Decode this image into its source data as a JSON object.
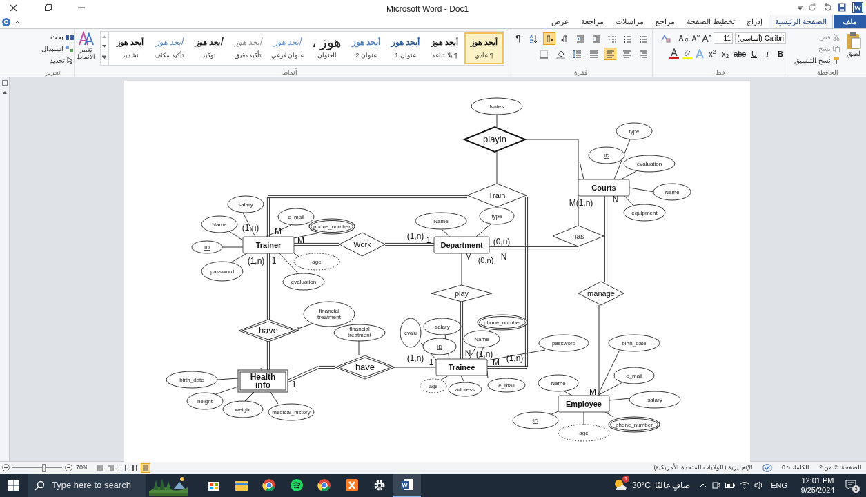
{
  "window": {
    "title": "Microsoft Word - Doc1"
  },
  "tabs": [
    {
      "label": "ملف",
      "kind": "file",
      "selected": false
    },
    {
      "label": "الصفحة الرئيسية",
      "kind": "tab",
      "selected": true
    },
    {
      "label": "إدراج",
      "kind": "tab",
      "selected": false
    },
    {
      "label": "تخطيط الصفحة",
      "kind": "tab",
      "selected": false
    },
    {
      "label": "مراجع",
      "kind": "tab",
      "selected": false
    },
    {
      "label": "مراسلات",
      "kind": "tab",
      "selected": false
    },
    {
      "label": "مراجعة",
      "kind": "tab",
      "selected": false
    },
    {
      "label": "عرض",
      "kind": "tab",
      "selected": false
    }
  ],
  "clipboard": {
    "paste": "لصق",
    "cut": "قص",
    "copy": "نسخ",
    "format_painter": "نسخ التنسيق",
    "group_label": "الحافظة"
  },
  "font": {
    "name": "Calibri (أساسي)",
    "size": "11",
    "group_label": "خط",
    "format_buttons": [
      {
        "label": "B",
        "kind": "bold"
      },
      {
        "label": "I",
        "kind": "italic"
      },
      {
        "label": "U",
        "kind": "underline"
      },
      {
        "label": "abc",
        "kind": "strike"
      },
      {
        "label": "x$_{2}$",
        "kind": "script"
      },
      {
        "label": "x$^{2}$",
        "kind": "script"
      }
    ]
  },
  "paragraph": {
    "group_label": "فقرة",
    "row1": [
      {
        "kind": "bullets",
        "selected": false
      },
      {
        "kind": "numbering",
        "selected": false
      },
      {
        "kind": "multilevel",
        "selected": false
      },
      {
        "kind": "outdent",
        "selected": false
      },
      {
        "kind": "indent",
        "selected": false
      },
      {
        "kind": "rtl",
        "selected": false
      },
      {
        "kind": "ltr",
        "selected": true
      },
      {
        "kind": "sort",
        "selected": false
      },
      {
        "kind": "marks",
        "label": "¶",
        "selected": false
      }
    ],
    "row2": [
      {
        "kind": "align-right",
        "selected": false
      },
      {
        "kind": "align-center",
        "selected": false
      },
      {
        "kind": "align-left",
        "selected": true
      },
      {
        "kind": "justify",
        "selected": false
      },
      {
        "kind": "spacing",
        "selected": false
      },
      {
        "kind": "shading",
        "selected": false
      },
      {
        "kind": "borders",
        "selected": false
      }
    ]
  },
  "styles": {
    "group_label": "أنماط",
    "change_styles": "تغيير الأنماط",
    "items": [
      {
        "preview": "أبجد هوز",
        "name": "¶ عادي",
        "kind": "normal",
        "selected": true
      },
      {
        "preview": "أبجد هوز",
        "name": "¶ بلا تباعد",
        "kind": "normal",
        "selected": false
      },
      {
        "preview": "أبجد هوز",
        "name": "عنوان 1",
        "kind": "heading1",
        "selected": false
      },
      {
        "preview": "أبجد هوز",
        "name": "عنوان 2",
        "kind": "heading2",
        "selected": false
      },
      {
        "preview": "هوز ،",
        "name": "العنوان",
        "kind": "title",
        "selected": false
      },
      {
        "preview": "أبجد هوز",
        "name": "عنوان فرعي",
        "kind": "subtitle",
        "selected": false
      },
      {
        "preview": "أبجد هوز",
        "name": "تأكيد دقيق",
        "kind": "subtle",
        "selected": false
      },
      {
        "preview": "أبجد هوز",
        "name": "توكيد",
        "kind": "emphasis",
        "selected": false
      },
      {
        "preview": "أبجد هوز",
        "name": "تأكيد مكثف",
        "kind": "intense",
        "selected": false
      },
      {
        "preview": "أبجد هوز",
        "name": "تشديد",
        "kind": "strong",
        "selected": false
      }
    ]
  },
  "editing": {
    "find": "بحث",
    "replace": "استبدال",
    "select": "تحديد",
    "group_label": "تحرير"
  },
  "diagram": {
    "entities": [
      {
        "label": "Trainer",
        "kind": "strong"
      },
      {
        "label": "Department",
        "kind": "strong"
      },
      {
        "label": "Courts",
        "kind": "strong"
      },
      {
        "label": "Trainee",
        "kind": "strong"
      },
      {
        "label": "Employee",
        "kind": "strong"
      },
      {
        "label": "Health info",
        "kind": "weak"
      }
    ],
    "relationships": [
      {
        "label": "playin",
        "kind": "bold"
      },
      {
        "label": "Train",
        "kind": "plain"
      },
      {
        "label": "Work",
        "kind": "plain"
      },
      {
        "label": "has",
        "kind": "plain"
      },
      {
        "label": "play",
        "kind": "plain"
      },
      {
        "label": "manage",
        "kind": "plain"
      },
      {
        "label": "have",
        "kind": "identifying"
      },
      {
        "label": "have",
        "kind": "identifying"
      }
    ],
    "attributes": [
      {
        "label": "Notes",
        "kind": "plain"
      },
      {
        "label": "type",
        "kind": "plain"
      },
      {
        "label": "evaluation",
        "kind": "plain"
      },
      {
        "label": "ID",
        "kind": "key"
      },
      {
        "label": "Name",
        "kind": "plain"
      },
      {
        "label": "equipment",
        "kind": "plain"
      },
      {
        "label": "salary",
        "kind": "plain"
      },
      {
        "label": "type",
        "kind": "plain"
      },
      {
        "label": "Name",
        "kind": "key"
      },
      {
        "label": "phone_number",
        "kind": "multivalued"
      },
      {
        "label": "e_mail",
        "kind": "plain"
      },
      {
        "label": "Name",
        "kind": "plain"
      },
      {
        "label": "ID",
        "kind": "key"
      },
      {
        "label": "age",
        "kind": "derived"
      },
      {
        "label": "evaluation",
        "kind": "plain"
      },
      {
        "label": "password",
        "kind": "plain"
      },
      {
        "label": "birth_date",
        "kind": "plain"
      },
      {
        "label": "password",
        "kind": "plain"
      },
      {
        "label": "phone_number",
        "kind": "multivalued"
      },
      {
        "label": "Name",
        "kind": "plain"
      },
      {
        "label": "salary",
        "kind": "plain"
      },
      {
        "label": "ID",
        "kind": "key"
      },
      {
        "label": "evalu",
        "kind": "plain"
      },
      {
        "label": "financial treatment",
        "kind": "plain"
      },
      {
        "label": "financial treatment",
        "kind": "plain"
      },
      {
        "label": "e_mail",
        "kind": "plain"
      },
      {
        "label": "Name",
        "kind": "plain"
      },
      {
        "label": "e_mail",
        "kind": "plain"
      },
      {
        "label": "address",
        "kind": "plain"
      },
      {
        "label": "age",
        "kind": "derived"
      },
      {
        "label": "birth_date",
        "kind": "plain"
      },
      {
        "label": "salary",
        "kind": "plain"
      },
      {
        "label": "phone_number",
        "kind": "multivalued"
      },
      {
        "label": "age",
        "kind": "derived"
      },
      {
        "label": "ID",
        "kind": "key"
      },
      {
        "label": "medical_history",
        "kind": "plain"
      },
      {
        "label": "weight",
        "kind": "plain"
      },
      {
        "label": "height",
        "kind": "plain"
      }
    ],
    "cardinalities": [
      "N",
      "M(1,n)",
      "(0,n)",
      "1",
      "(1,n)",
      "M",
      "M",
      "(1,n)",
      "N",
      "(0,n)",
      "M",
      "1",
      "(1,n)",
      "1",
      "(1,n)",
      "M",
      "(1,n)",
      "N",
      "1",
      "(1,n)",
      "1",
      "M",
      "1"
    ]
  },
  "status_bar": {
    "page": "الصفحة: 2 من 2",
    "words": "الكلمات: 0",
    "language": "الإنجليزية (الولايات المتحدة الأمريكية)",
    "zoom": "70%"
  },
  "taskbar": {
    "search_placeholder": "Type here to search",
    "apps": [
      {
        "kind": "store",
        "active": false
      },
      {
        "kind": "folder",
        "active": false
      },
      {
        "kind": "chrome",
        "active": false
      },
      {
        "kind": "spotify",
        "active": false
      },
      {
        "kind": "chrome",
        "active": false
      },
      {
        "kind": "xampp",
        "active": false
      },
      {
        "kind": "settings",
        "active": false
      },
      {
        "kind": "word",
        "active": true
      }
    ],
    "weather_badge": "1",
    "temperature": "30°C",
    "weather": "صافٍ غالبًا",
    "language": "ENG",
    "time": "12:01 PM",
    "date": "9/25/2024",
    "notifications": "3"
  }
}
